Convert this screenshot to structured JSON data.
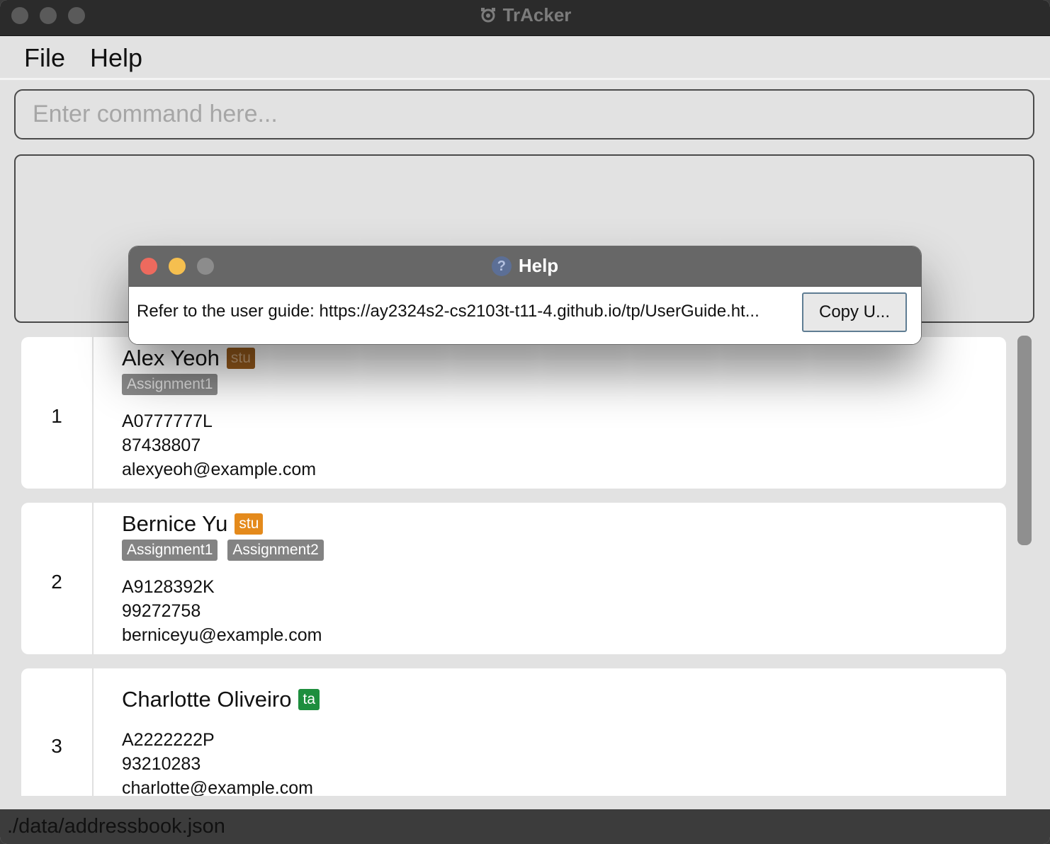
{
  "window": {
    "title": "TrAcker"
  },
  "menu": {
    "file": "File",
    "help": "Help"
  },
  "command": {
    "placeholder": "Enter command here...",
    "value": ""
  },
  "result": {
    "text": ""
  },
  "persons": [
    {
      "index": "1",
      "name": "Alex Yeoh",
      "role": "stu",
      "tags": [
        "Assignment1"
      ],
      "id": "A0777777L",
      "phone": "87438807",
      "email": "alexyeoh@example.com"
    },
    {
      "index": "2",
      "name": "Bernice Yu",
      "role": "stu",
      "tags": [
        "Assignment1",
        "Assignment2"
      ],
      "id": "A9128392K",
      "phone": "99272758",
      "email": "berniceyu@example.com"
    },
    {
      "index": "3",
      "name": "Charlotte Oliveiro",
      "role": "ta",
      "tags": [],
      "id": "A2222222P",
      "phone": "93210283",
      "email": "charlotte@example.com"
    }
  ],
  "status": {
    "file_path": "./data/addressbook.json"
  },
  "help_dialog": {
    "title": "Help",
    "message": "Refer to the user guide: https://ay2324s2-cs2103t-t11-4.github.io/tp/UserGuide.ht...",
    "copy_label": "Copy U..."
  },
  "colors": {
    "role_stu": "#e48a1c",
    "role_ta": "#1e8e3e",
    "tag": "#838383",
    "titlebar": "#2b2b2b",
    "close": "#ed6a5e",
    "minimize": "#f5bf4f"
  },
  "icons": {
    "app": "tracker-app-icon",
    "help": "question-mark-icon"
  }
}
